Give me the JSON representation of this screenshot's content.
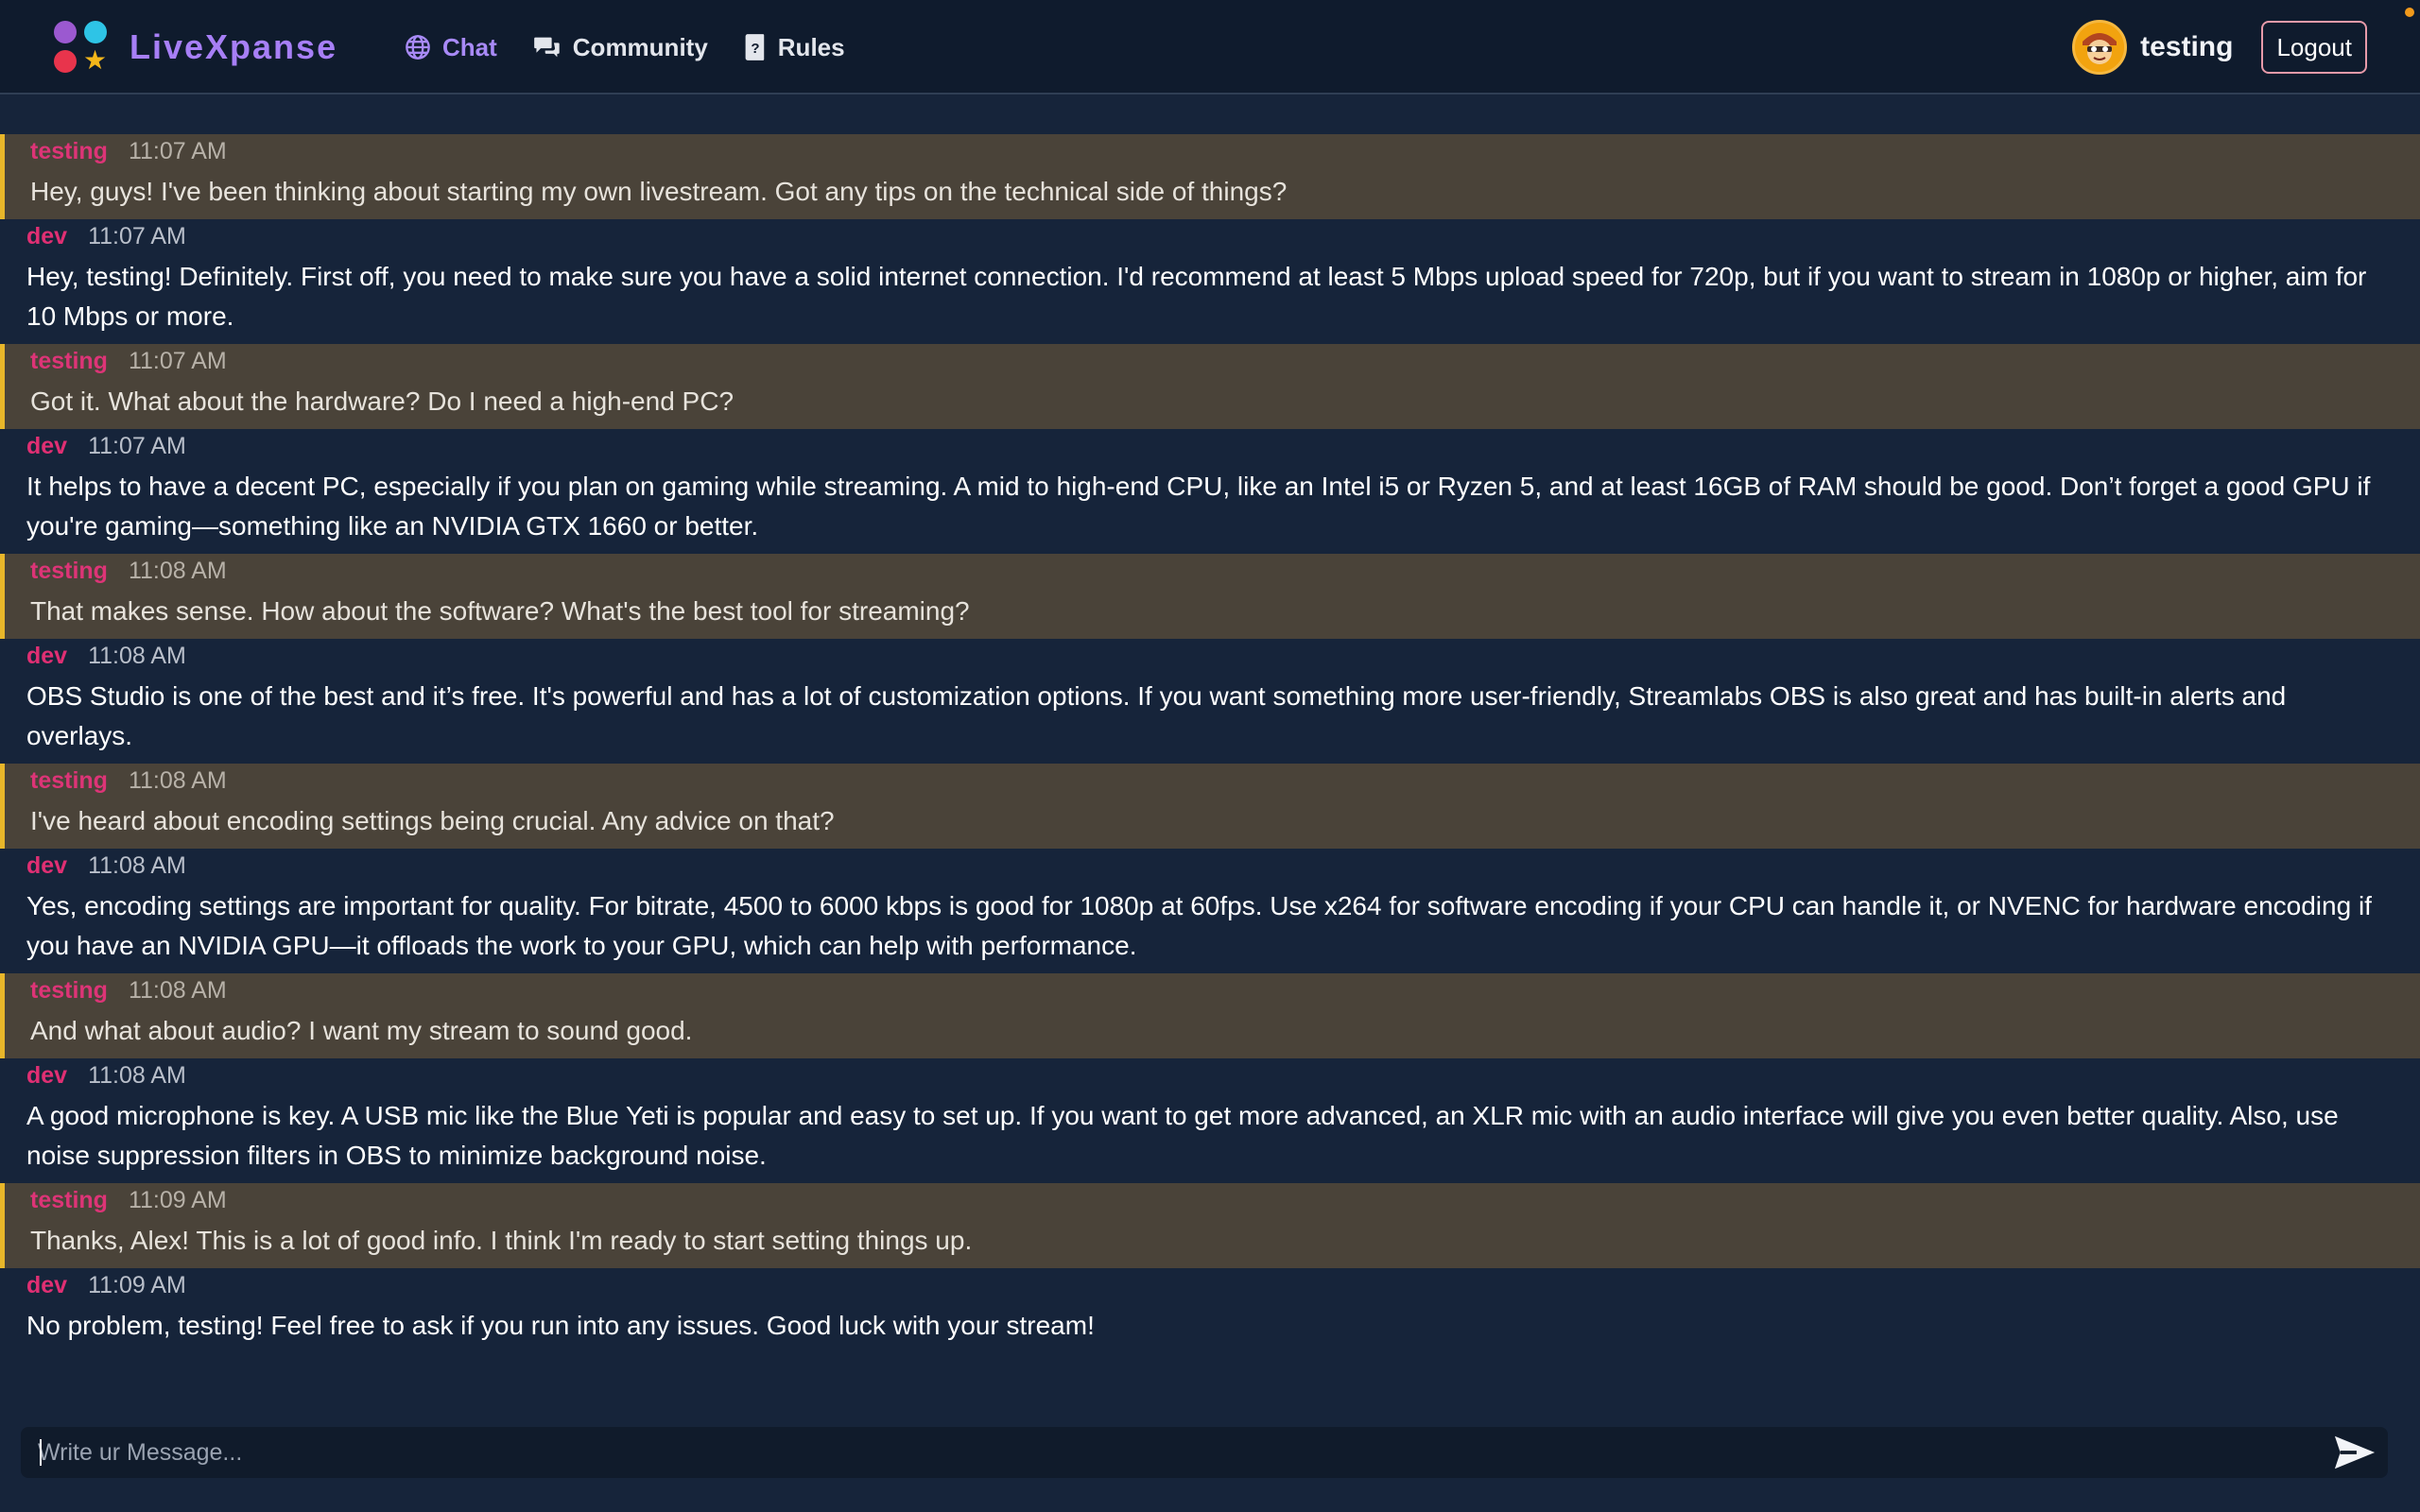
{
  "app": {
    "name": "LiveXpanse",
    "name_color": "#a77ff6",
    "logo_colors": [
      "#9b59d0",
      "#2ec4e6",
      "#e8344c",
      "#f4b71a"
    ]
  },
  "nav": {
    "items": [
      {
        "label": "Chat",
        "icon": "globe-icon",
        "active": true
      },
      {
        "label": "Community",
        "icon": "chat-bubbles-icon",
        "active": false
      },
      {
        "label": "Rules",
        "icon": "rulebook-icon",
        "active": false
      }
    ]
  },
  "user": {
    "username": "testing",
    "avatar": "cartoon-avatar-icon",
    "logout_label": "Logout"
  },
  "messages": [
    {
      "author": "testing",
      "time": "11:07 AM",
      "self": true,
      "text": "Hey, guys! I've been thinking about starting my own livestream. Got any tips on the technical side of things?"
    },
    {
      "author": "dev",
      "time": "11:07 AM",
      "self": false,
      "text": "Hey, testing! Definitely. First off, you need to make sure you have a solid internet connection. I'd recommend at least 5 Mbps upload speed for 720p, but if you want to stream in 1080p or higher, aim for 10 Mbps or more."
    },
    {
      "author": "testing",
      "time": "11:07 AM",
      "self": true,
      "text": "Got it. What about the hardware? Do I need a high-end PC?"
    },
    {
      "author": "dev",
      "time": "11:07 AM",
      "self": false,
      "text": "It helps to have a decent PC, especially if you plan on gaming while streaming. A mid to high-end CPU, like an Intel i5 or Ryzen 5, and at least 16GB of RAM should be good. Don’t forget a good GPU if you're gaming—something like an NVIDIA GTX 1660 or better."
    },
    {
      "author": "testing",
      "time": "11:08 AM",
      "self": true,
      "text": "That makes sense. How about the software? What's the best tool for streaming?"
    },
    {
      "author": "dev",
      "time": "11:08 AM",
      "self": false,
      "text": "OBS Studio is one of the best and it’s free. It's powerful and has a lot of customization options. If you want something more user-friendly, Streamlabs OBS is also great and has built-in alerts and overlays."
    },
    {
      "author": "testing",
      "time": "11:08 AM",
      "self": true,
      "text": "I've heard about encoding settings being crucial. Any advice on that?"
    },
    {
      "author": "dev",
      "time": "11:08 AM",
      "self": false,
      "text": "Yes, encoding settings are important for quality. For bitrate, 4500 to 6000 kbps is good for 1080p at 60fps. Use x264 for software encoding if your CPU can handle it, or NVENC for hardware encoding if you have an NVIDIA GPU—it offloads the work to your GPU, which can help with performance."
    },
    {
      "author": "testing",
      "time": "11:08 AM",
      "self": true,
      "text": "And what about audio? I want my stream to sound good."
    },
    {
      "author": "dev",
      "time": "11:08 AM",
      "self": false,
      "text": "A good microphone is key. A USB mic like the Blue Yeti is popular and easy to set up. If you want to get more advanced, an XLR mic with an audio interface will give you even better quality. Also, use noise suppression filters in OBS to minimize background noise."
    },
    {
      "author": "testing",
      "time": "11:09 AM",
      "self": true,
      "text": "Thanks, Alex! This is a lot of good info. I think I'm ready to start setting things up."
    },
    {
      "author": "dev",
      "time": "11:09 AM",
      "self": false,
      "text": "No problem, testing! Feel free to ask if you run into any issues. Good luck with your stream!"
    }
  ],
  "composer": {
    "placeholder": "Write ur Message...",
    "value": "",
    "send_icon": "send-arrow-icon"
  }
}
